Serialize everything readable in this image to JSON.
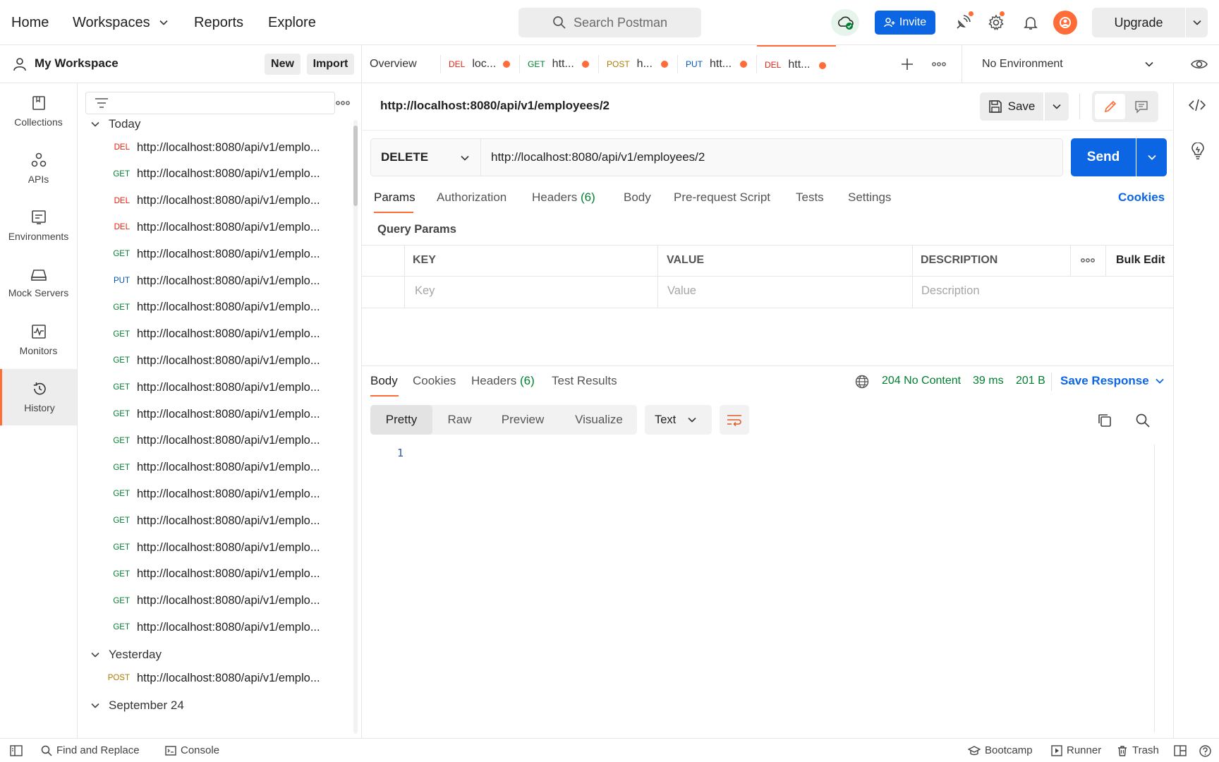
{
  "topbar": {
    "nav": [
      "Home",
      "Workspaces",
      "Reports",
      "Explore"
    ],
    "search_placeholder": "Search Postman",
    "invite_label": "Invite",
    "upgrade_label": "Upgrade"
  },
  "workspace": {
    "title": "My Workspace",
    "new_label": "New",
    "import_label": "Import"
  },
  "rail": {
    "items": [
      {
        "label": "Collections",
        "icon": "collections-icon"
      },
      {
        "label": "APIs",
        "icon": "apis-icon"
      },
      {
        "label": "Environments",
        "icon": "environments-icon"
      },
      {
        "label": "Mock Servers",
        "icon": "mock-servers-icon"
      },
      {
        "label": "Monitors",
        "icon": "monitors-icon"
      },
      {
        "label": "History",
        "icon": "history-icon",
        "active": true
      }
    ]
  },
  "history": {
    "groups": [
      {
        "label": "Today",
        "items": [
          {
            "method": "DEL",
            "url": "http://localhost:8080/api/v1/emplo..."
          },
          {
            "method": "GET",
            "url": "http://localhost:8080/api/v1/emplo..."
          },
          {
            "method": "DEL",
            "url": "http://localhost:8080/api/v1/emplo..."
          },
          {
            "method": "DEL",
            "url": "http://localhost:8080/api/v1/emplo..."
          },
          {
            "method": "GET",
            "url": "http://localhost:8080/api/v1/emplo..."
          },
          {
            "method": "PUT",
            "url": "http://localhost:8080/api/v1/emplo..."
          },
          {
            "method": "GET",
            "url": "http://localhost:8080/api/v1/emplo..."
          },
          {
            "method": "GET",
            "url": "http://localhost:8080/api/v1/emplo..."
          },
          {
            "method": "GET",
            "url": "http://localhost:8080/api/v1/emplo..."
          },
          {
            "method": "GET",
            "url": "http://localhost:8080/api/v1/emplo..."
          },
          {
            "method": "GET",
            "url": "http://localhost:8080/api/v1/emplo..."
          },
          {
            "method": "GET",
            "url": "http://localhost:8080/api/v1/emplo..."
          },
          {
            "method": "GET",
            "url": "http://localhost:8080/api/v1/emplo..."
          },
          {
            "method": "GET",
            "url": "http://localhost:8080/api/v1/emplo..."
          },
          {
            "method": "GET",
            "url": "http://localhost:8080/api/v1/emplo..."
          },
          {
            "method": "GET",
            "url": "http://localhost:8080/api/v1/emplo..."
          },
          {
            "method": "GET",
            "url": "http://localhost:8080/api/v1/emplo..."
          },
          {
            "method": "GET",
            "url": "http://localhost:8080/api/v1/emplo..."
          },
          {
            "method": "GET",
            "url": "http://localhost:8080/api/v1/emplo..."
          }
        ]
      },
      {
        "label": "Yesterday",
        "items": [
          {
            "method": "POST",
            "url": "http://localhost:8080/api/v1/emplo..."
          }
        ]
      },
      {
        "label": "September 24",
        "items": []
      }
    ]
  },
  "tabs": {
    "items": [
      {
        "method": "",
        "label": "Overview",
        "unsaved": false
      },
      {
        "method": "DEL",
        "label": "loc...",
        "unsaved": true
      },
      {
        "method": "GET",
        "label": "htt...",
        "unsaved": true
      },
      {
        "method": "POST",
        "label": "h...",
        "unsaved": true
      },
      {
        "method": "PUT",
        "label": "htt...",
        "unsaved": true
      },
      {
        "method": "DEL",
        "label": "htt...",
        "unsaved": true,
        "active": true
      }
    ],
    "environment": "No Environment"
  },
  "request": {
    "name": "http://localhost:8080/api/v1/employees/2",
    "save_label": "Save",
    "method": "DELETE",
    "url": "http://localhost:8080/api/v1/employees/2",
    "send_label": "Send",
    "tabs": [
      {
        "label": "Params",
        "active": true
      },
      {
        "label": "Authorization"
      },
      {
        "label": "Headers",
        "count": "(6)"
      },
      {
        "label": "Body"
      },
      {
        "label": "Pre-request Script"
      },
      {
        "label": "Tests"
      },
      {
        "label": "Settings"
      }
    ],
    "cookies_label": "Cookies",
    "query_params_title": "Query Params",
    "table": {
      "headers": [
        "KEY",
        "VALUE",
        "DESCRIPTION"
      ],
      "bulk_edit": "Bulk Edit",
      "placeholders": [
        "Key",
        "Value",
        "Description"
      ]
    }
  },
  "response": {
    "tabs": [
      {
        "label": "Body",
        "active": true
      },
      {
        "label": "Cookies"
      },
      {
        "label": "Headers",
        "count": "(6)"
      },
      {
        "label": "Test Results"
      }
    ],
    "status": "204 No Content",
    "time": "39 ms",
    "size": "201 B",
    "save_response_label": "Save Response",
    "formats": [
      "Pretty",
      "Raw",
      "Preview",
      "Visualize"
    ],
    "language": "Text",
    "line_numbers": [
      "1"
    ]
  },
  "statusbar": {
    "find_replace": "Find and Replace",
    "console": "Console",
    "bootcamp": "Bootcamp",
    "runner": "Runner",
    "trash": "Trash"
  },
  "colors": {
    "accent": "#ff6c37",
    "primary": "#0c66e4",
    "get": "#007f31",
    "del": "#eb2013",
    "post": "#ad7a03",
    "put": "#0053b8"
  }
}
